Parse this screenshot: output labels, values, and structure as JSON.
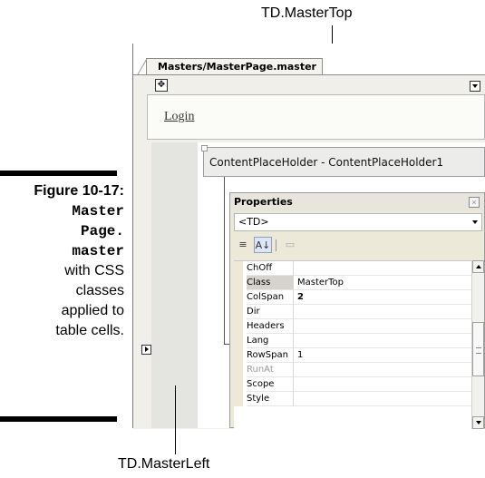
{
  "callouts": {
    "top_label": "TD.MasterTop",
    "bottom_label": "TD.MasterLeft"
  },
  "caption": {
    "figure_label": "Figure 10-17:",
    "line_mono_1": "Master",
    "line_mono_2": "Page.",
    "line_mono_3": "master",
    "line_text_1": "with CSS",
    "line_text_2": "classes",
    "line_text_3": "applied to",
    "line_text_4": "table cells."
  },
  "designer": {
    "tab_label": "Masters/MasterPage.master",
    "login_link": "Login",
    "content_placeholder_label": "ContentPlaceHolder - ContentPlaceHolder1"
  },
  "properties": {
    "title": "Properties",
    "close_glyph": "×",
    "object_selector": "<TD>",
    "toolbar": {
      "categorized_glyph": "≡",
      "alphabetical_glyph": "A↓",
      "pages_glyph": "▭"
    },
    "rows": [
      {
        "name": "ChOff",
        "value": ""
      },
      {
        "name": "Class",
        "value": "MasterTop"
      },
      {
        "name": "ColSpan",
        "value": "2"
      },
      {
        "name": "Dir",
        "value": ""
      },
      {
        "name": "Headers",
        "value": ""
      },
      {
        "name": "Lang",
        "value": ""
      },
      {
        "name": "RowSpan",
        "value": "1"
      },
      {
        "name": "RunAt",
        "value": ""
      },
      {
        "name": "Scope",
        "value": ""
      },
      {
        "name": "Style",
        "value": ""
      }
    ]
  },
  "colors": {
    "master_left_fill": "#e4e4e0",
    "selected_row": "#d6d3ce",
    "pane_background": "#ece9d8"
  }
}
